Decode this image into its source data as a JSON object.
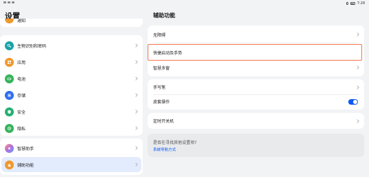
{
  "status": {
    "time": "7:28"
  },
  "left": {
    "title": "设置",
    "partial_top_label": "通知",
    "group1": [
      {
        "label": "生物识别和密码",
        "icon": "key-icon",
        "color": "#1aa1a6"
      },
      {
        "label": "应用",
        "icon": "apps-icon",
        "color": "#f0982d"
      },
      {
        "label": "电池",
        "icon": "battery-icon",
        "color": "#35b35a"
      },
      {
        "label": "存储",
        "icon": "storage-icon",
        "color": "#2f6df0"
      },
      {
        "label": "安全",
        "icon": "shield-icon",
        "color": "#25b070"
      },
      {
        "label": "隐私",
        "icon": "privacy-icon",
        "color": "#35b35a"
      }
    ],
    "group2": [
      {
        "label": "智慧助手",
        "icon": "assistant-icon",
        "color": "#b36fe0"
      },
      {
        "label": "辅助功能",
        "icon": "hand-icon",
        "color": "#f0982d",
        "selected": true
      }
    ]
  },
  "right": {
    "title": "辅助功能",
    "card1": [
      {
        "label": "无障碍"
      },
      {
        "label": "快捷启动及手势",
        "highlighted": true
      },
      {
        "label": "智慧多窗"
      }
    ],
    "card2": [
      {
        "label": "手写笔"
      },
      {
        "label": "皮套操作",
        "toggle": true
      }
    ],
    "card3": [
      {
        "label": "定时开关机"
      }
    ],
    "suggestion": {
      "question": "是否在寻找其他设置项?",
      "link": "系统导航方式"
    }
  },
  "colors": {
    "accent": "#0a59f7",
    "highlight_border": "#f0754a"
  }
}
